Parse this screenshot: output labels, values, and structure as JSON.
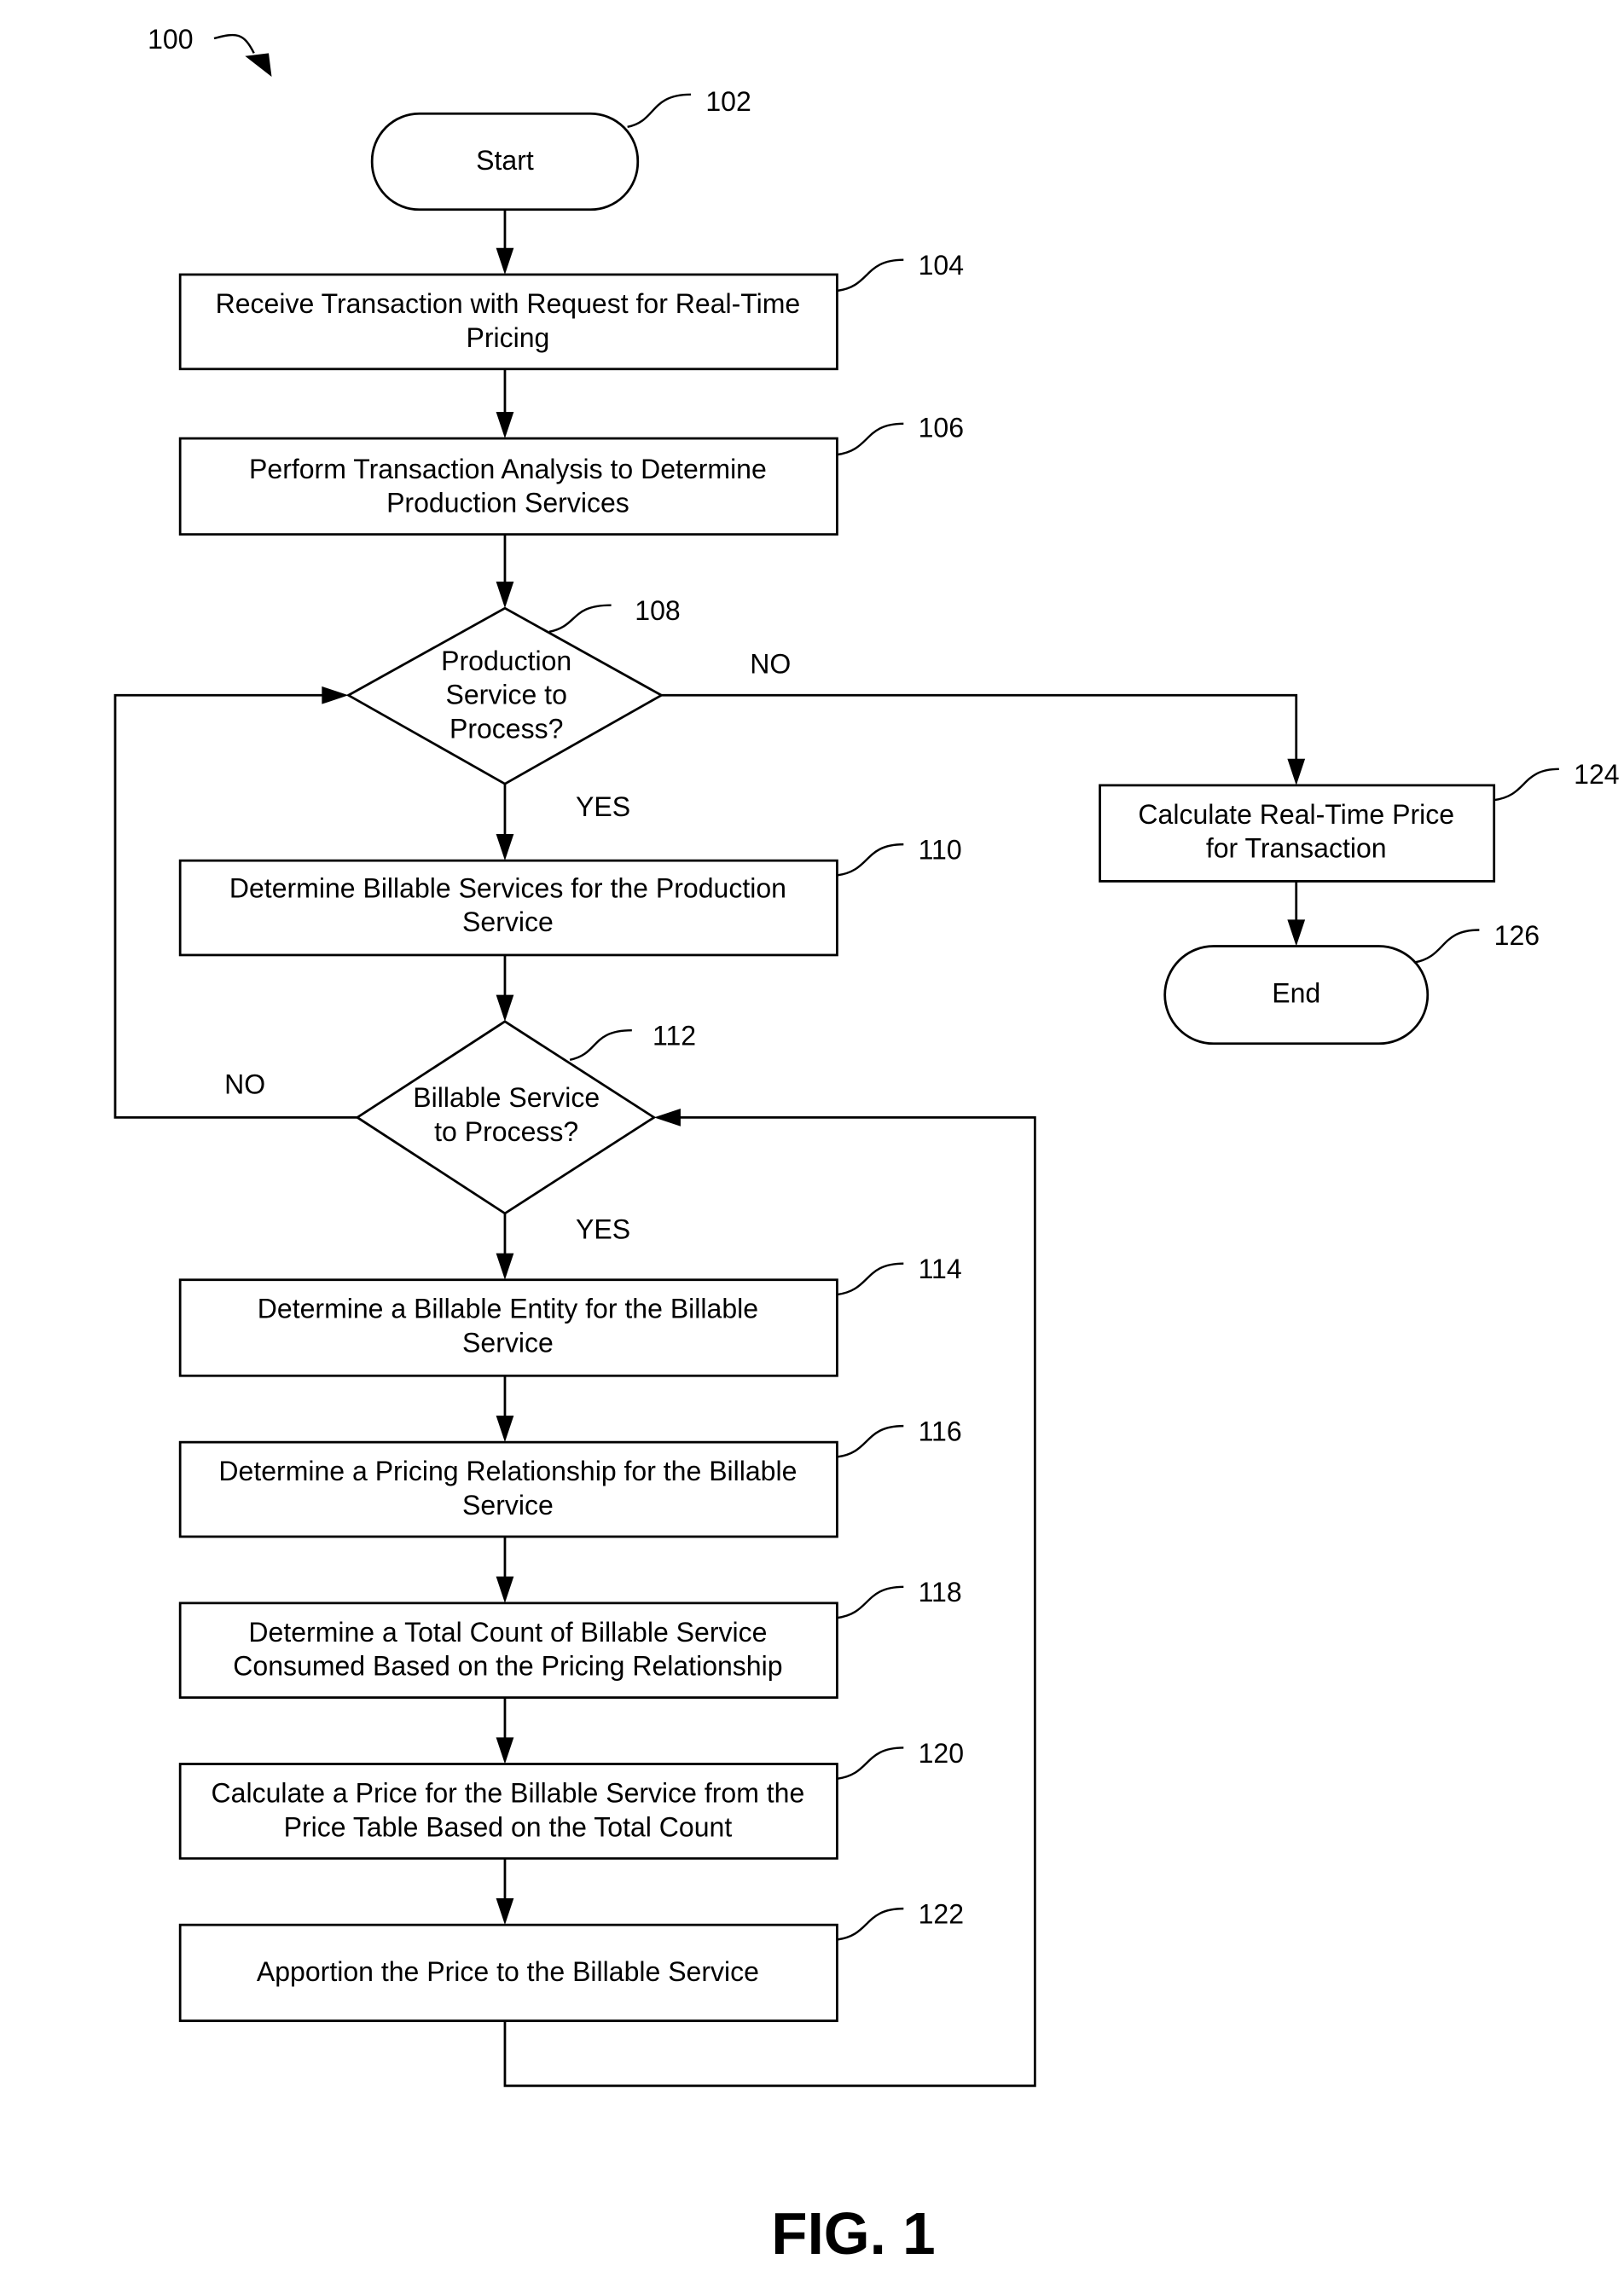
{
  "figure": {
    "number_ref": "100",
    "caption": "FIG. 1"
  },
  "nodes": {
    "start": {
      "ref": "102",
      "lines": [
        "Start"
      ]
    },
    "n104": {
      "ref": "104",
      "lines": [
        "Receive Transaction with Request for Real-Time",
        "Pricing"
      ]
    },
    "n106": {
      "ref": "106",
      "lines": [
        "Perform Transaction Analysis to Determine",
        "Production Services"
      ]
    },
    "d108": {
      "ref": "108",
      "lines": [
        "Production",
        "Service to",
        "Process?"
      ]
    },
    "n110": {
      "ref": "110",
      "lines": [
        "Determine Billable Services for the Production",
        "Service"
      ]
    },
    "d112": {
      "ref": "112",
      "lines": [
        "Billable Service",
        "to Process?"
      ]
    },
    "n114": {
      "ref": "114",
      "lines": [
        "Determine a Billable Entity for the Billable",
        "Service"
      ]
    },
    "n116": {
      "ref": "116",
      "lines": [
        "Determine a Pricing Relationship for the Billable",
        "Service"
      ]
    },
    "n118": {
      "ref": "118",
      "lines": [
        "Determine a Total Count of Billable Service",
        "Consumed Based on the Pricing Relationship"
      ]
    },
    "n120": {
      "ref": "120",
      "lines": [
        "Calculate a Price for the Billable Service from the",
        "Price Table Based on the Total Count"
      ]
    },
    "n122": {
      "ref": "122",
      "lines": [
        "Apportion the Price to the Billable Service"
      ]
    },
    "n124": {
      "ref": "124",
      "lines": [
        "Calculate Real-Time Price",
        "for Transaction"
      ]
    },
    "end": {
      "ref": "126",
      "lines": [
        "End"
      ]
    }
  },
  "edge_labels": {
    "d108_no": "NO",
    "d108_yes": "YES",
    "d112_no": "NO",
    "d112_yes": "YES"
  }
}
